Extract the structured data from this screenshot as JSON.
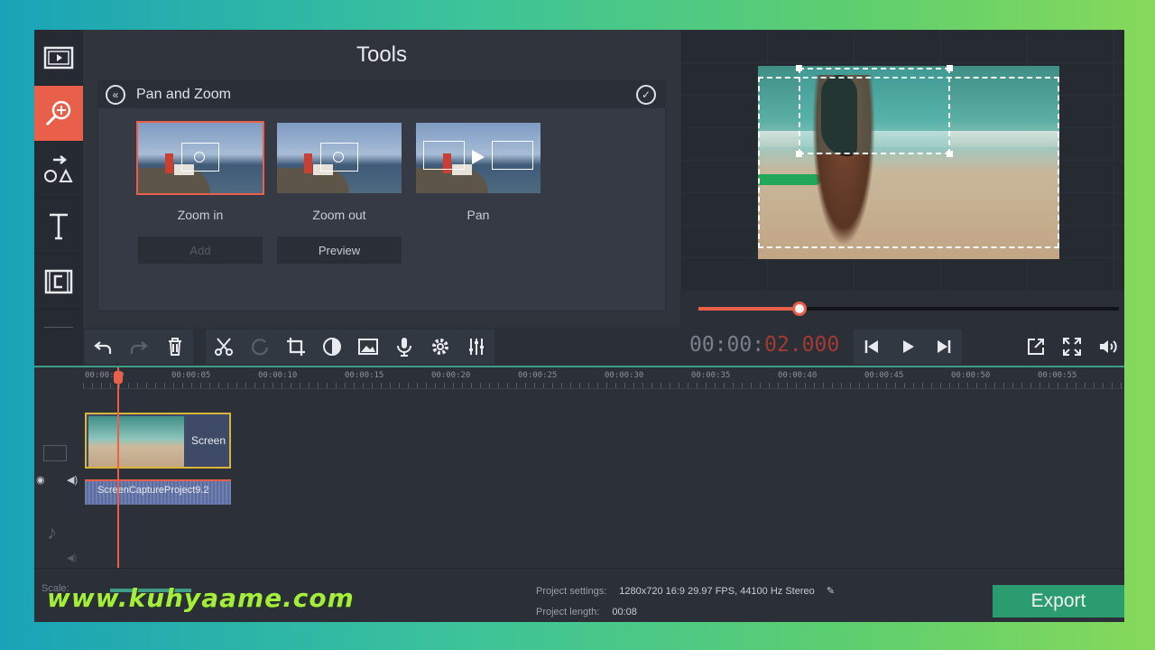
{
  "sidebar": {
    "items": [
      {
        "icon": "film-clip-icon"
      },
      {
        "icon": "zoom-tool-icon",
        "active": true
      },
      {
        "icon": "transitions-icon"
      },
      {
        "icon": "titles-icon"
      },
      {
        "icon": "filters-icon"
      },
      {
        "icon": "more-menu-icon"
      }
    ]
  },
  "tools": {
    "title": "Tools",
    "panel_title": "Pan and Zoom",
    "presets": [
      {
        "label": "Zoom in",
        "selected": true
      },
      {
        "label": "Zoom out",
        "selected": false
      },
      {
        "label": "Pan",
        "selected": false
      }
    ],
    "add_label": "Add",
    "preview_label": "Preview"
  },
  "player": {
    "progress_percent": 24,
    "timecode_grey": "00:00:",
    "timecode_red": "02.000"
  },
  "timeline": {
    "ticks": [
      "00:00:00",
      "00:00:05",
      "00:00:10",
      "00:00:15",
      "00:00:20",
      "00:00:25",
      "00:00:30",
      "00:00:35",
      "00:00:40",
      "00:00:45",
      "00:00:50",
      "00:00:55"
    ],
    "video_clip_label": "Screen",
    "audio_clip_label": "ScreenCaptureProject9.2"
  },
  "footer": {
    "scale_label": "Scale:",
    "project_settings_label": "Project settings:",
    "project_settings_value": "1280x720 16:9 29.97 FPS, 44100 Hz Stereo",
    "project_length_label": "Project length:",
    "project_length_value": "00:08",
    "export_label": "Export"
  },
  "watermark": "www.kuhyaame.com",
  "colors": {
    "accent": "#e8604a",
    "export": "#2b9c70",
    "watermark": "#a5ec3c"
  }
}
